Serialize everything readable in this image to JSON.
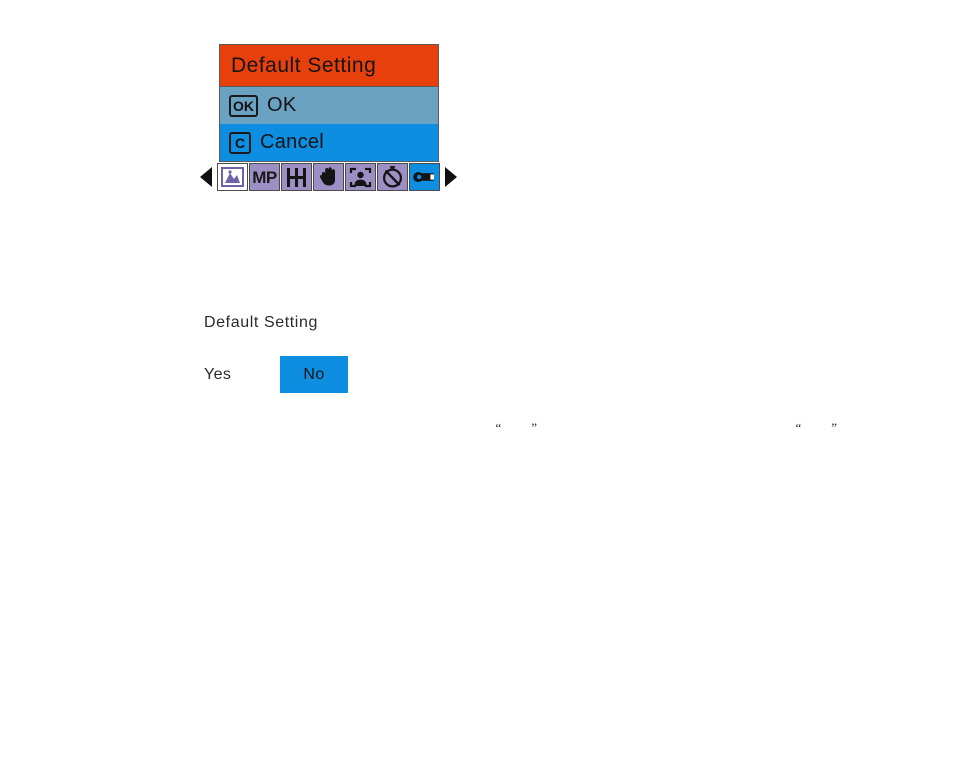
{
  "lcd_dialog": {
    "title": "Default Setting",
    "title_bg": "#e8400c",
    "border_color": "#5b5b5b",
    "rows": [
      {
        "key": "OK",
        "label": "OK",
        "bg": "#6ba1c1",
        "selected": false
      },
      {
        "key": "C",
        "label": "Cancel",
        "bg": "#0e8ee0",
        "selected": true
      }
    ]
  },
  "mode_bar": {
    "prev_arrow": "triangle-left-icon",
    "next_arrow": "triangle-right-icon",
    "icons": [
      {
        "name": "scene-mountain-icon",
        "state": "selected",
        "bg": "#ffffff"
      },
      {
        "name": "megapixel-icon",
        "label": "MP",
        "state": "normal",
        "bg": "#9b8fc4"
      },
      {
        "name": "iso-film-icon",
        "state": "normal",
        "bg": "#9b8fc4"
      },
      {
        "name": "anti-shake-hand-icon",
        "state": "normal",
        "bg": "#9b8fc4"
      },
      {
        "name": "face-detection-icon",
        "state": "normal",
        "bg": "#9b8fc4"
      },
      {
        "name": "self-timer-off-icon",
        "state": "normal",
        "bg": "#9b8fc4"
      },
      {
        "name": "setup-wrench-icon",
        "state": "active",
        "bg": "#0e8ee0"
      }
    ]
  },
  "confirm_block": {
    "heading": "Default Setting",
    "yes_label": "Yes",
    "no_label": "No",
    "no_bg": "#0e8ee0",
    "selected": "No"
  },
  "quote_marks": {
    "left": {
      "open": "“",
      "close": "”",
      "inner_text": ""
    },
    "right": {
      "open": "“",
      "close": "”",
      "inner_text": ""
    }
  }
}
